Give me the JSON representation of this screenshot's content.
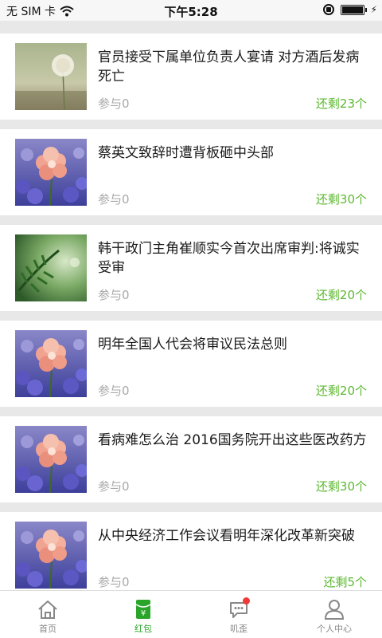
{
  "status_bar": {
    "carrier": "无 SIM 卡",
    "time": "下午5:28"
  },
  "items": [
    {
      "title": "官员接受下属单位负责人宴请 对方酒后发病死亡",
      "joined": "参与0",
      "remain": "还剩23个",
      "thumb": "dandelion"
    },
    {
      "title": "蔡英文致辞时遭背板砸中头部",
      "joined": "参与0",
      "remain": "还剩30个",
      "thumb": "flower"
    },
    {
      "title": "韩干政门主角崔顺实今首次出席审判:将诚实受审",
      "joined": "参与0",
      "remain": "还剩20个",
      "thumb": "pine"
    },
    {
      "title": "明年全国人代会将审议民法总则",
      "joined": "参与0",
      "remain": "还剩20个",
      "thumb": "flower"
    },
    {
      "title": "看病难怎么治 2016国务院开出这些医改药方",
      "joined": "参与0",
      "remain": "还剩30个",
      "thumb": "flower"
    },
    {
      "title": "从中央经济工作会议看明年深化改革新突破",
      "joined": "参与0",
      "remain": "还剩5个",
      "thumb": "flower"
    }
  ],
  "tabs": [
    {
      "label": "首页",
      "icon": "home-icon",
      "active": false
    },
    {
      "label": "红包",
      "icon": "red-packet-icon",
      "active": true
    },
    {
      "label": "叽歪",
      "icon": "chat-bubble-icon",
      "active": false,
      "badge": true
    },
    {
      "label": "个人中心",
      "icon": "user-icon",
      "active": false
    }
  ],
  "colors": {
    "accent_green": "#5cb830",
    "tab_active": "#2aa52a",
    "badge_red": "#f03a3a",
    "muted_text": "#a8a8a8",
    "separator": "#e8e8e8"
  }
}
